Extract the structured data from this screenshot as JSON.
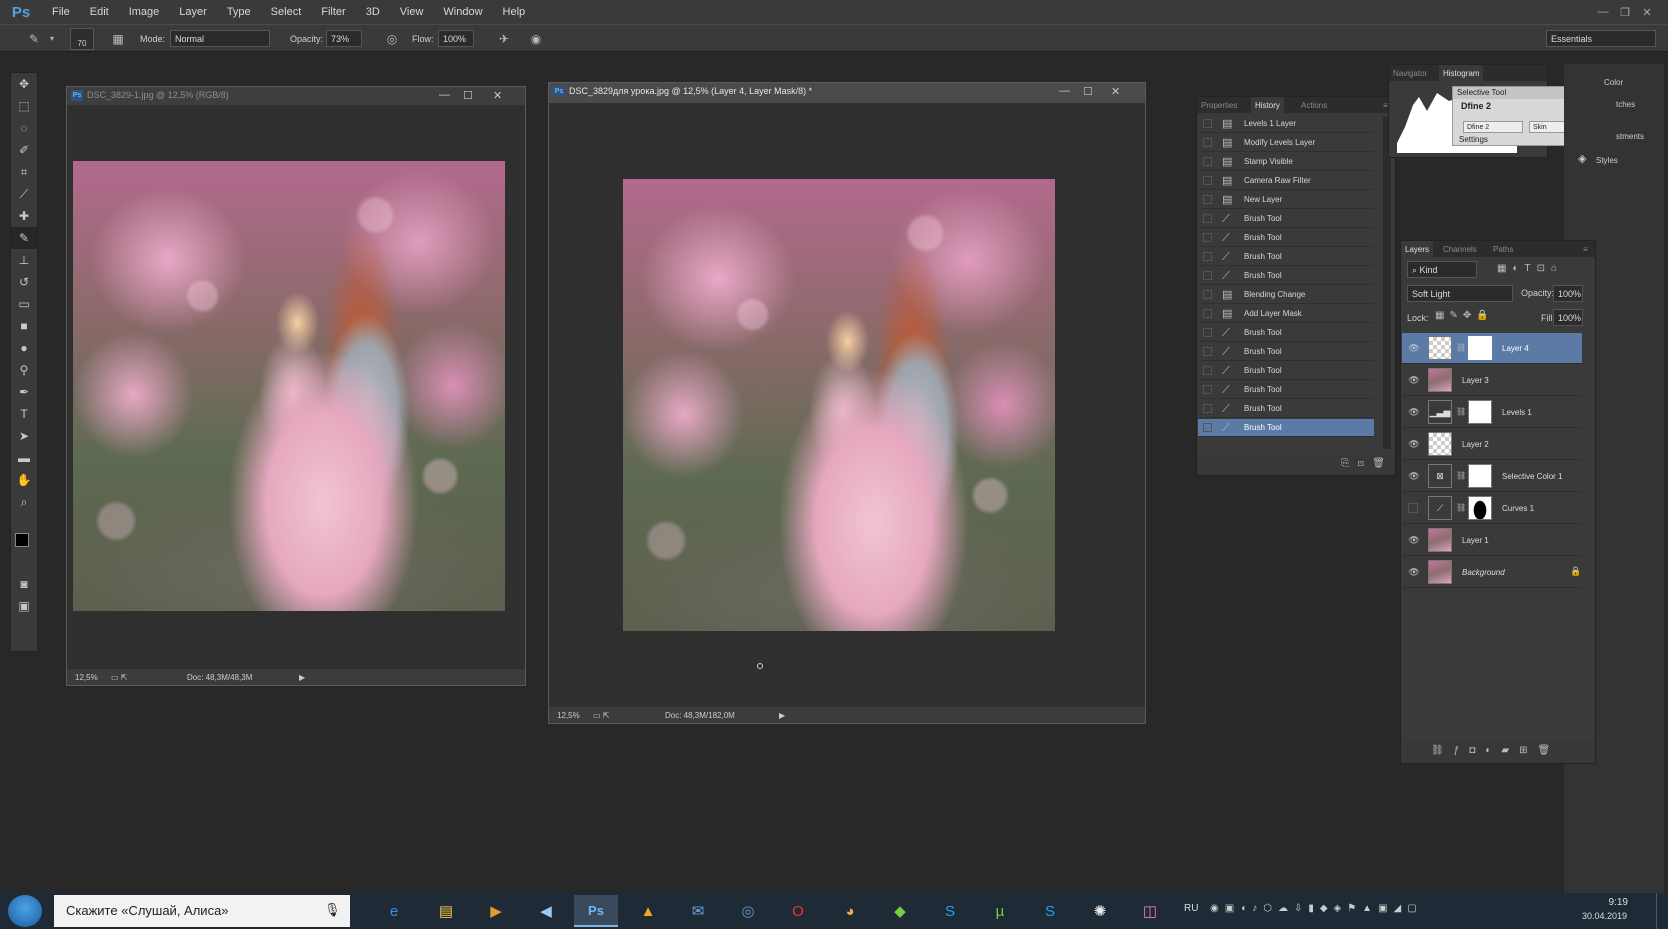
{
  "menubar": {
    "logo": "Ps",
    "items": [
      "File",
      "Edit",
      "Image",
      "Layer",
      "Type",
      "Select",
      "Filter",
      "3D",
      "View",
      "Window",
      "Help"
    ]
  },
  "options": {
    "brush_size": "70",
    "mode_label": "Mode:",
    "mode_value": "Normal",
    "opacity_label": "Opacity:",
    "opacity_value": "73%",
    "flow_label": "Flow:",
    "flow_value": "100%",
    "workspace": "Essentials"
  },
  "doc1": {
    "title": "DSC_3829-1.jpg @ 12,5% (RGB/8)",
    "zoom": "12,5%",
    "doc_size": "Doc: 48,3M/48,3M"
  },
  "doc2": {
    "title": "DSC_3829для урока.jpg @ 12,5% (Layer 4, Layer Mask/8) *",
    "zoom": "12,5%",
    "doc_size": "Doc: 48,3M/182,0M"
  },
  "history_panel": {
    "tabs": [
      "Properties",
      "History",
      "Actions"
    ],
    "active_tab": "History",
    "items": [
      {
        "label": "Levels 1 Layer",
        "icon": "doc-icon"
      },
      {
        "label": "Modify Levels Layer",
        "icon": "doc-icon"
      },
      {
        "label": "Stamp Visible",
        "icon": "doc-icon"
      },
      {
        "label": "Camera Raw Filter",
        "icon": "doc-icon"
      },
      {
        "label": "New Layer",
        "icon": "doc-icon"
      },
      {
        "label": "Brush Tool",
        "icon": "brush-icon"
      },
      {
        "label": "Brush Tool",
        "icon": "brush-icon"
      },
      {
        "label": "Brush Tool",
        "icon": "brush-icon"
      },
      {
        "label": "Brush Tool",
        "icon": "brush-icon"
      },
      {
        "label": "Blending Change",
        "icon": "doc-icon"
      },
      {
        "label": "Add Layer Mask",
        "icon": "doc-icon"
      },
      {
        "label": "Brush Tool",
        "icon": "brush-icon"
      },
      {
        "label": "Brush Tool",
        "icon": "brush-icon"
      },
      {
        "label": "Brush Tool",
        "icon": "brush-icon"
      },
      {
        "label": "Brush Tool",
        "icon": "brush-icon"
      },
      {
        "label": "Brush Tool",
        "icon": "brush-icon"
      },
      {
        "label": "Brush Tool",
        "icon": "brush-icon"
      }
    ],
    "selected_index": 16
  },
  "navigator_panel": {
    "tabs": [
      "Navigator",
      "Histogram"
    ],
    "active_tab": "Histogram"
  },
  "selective_tool": {
    "title": "Selective Tool",
    "group": "Dfine 2",
    "btn1": "Dfine 2",
    "btn2": "Skin",
    "settings": "Settings"
  },
  "side_dock": {
    "color": "Color",
    "swatches": "tches",
    "adjustments": "stments",
    "styles": "Styles"
  },
  "layers_panel": {
    "tabs": [
      "Layers",
      "Channels",
      "Paths"
    ],
    "active_tab": "Layers",
    "kind_label": "Kind",
    "blend_mode": "Soft Light",
    "opacity_label": "Opacity:",
    "opacity_value": "100%",
    "lock_label": "Lock:",
    "fill_label": "Fill:",
    "fill_value": "100%",
    "layers": [
      {
        "name": "Layer 4",
        "visible": true,
        "selected": true
      },
      {
        "name": "Layer 3",
        "visible": true,
        "selected": false
      },
      {
        "name": "Levels 1",
        "visible": true,
        "selected": false
      },
      {
        "name": "Layer 2",
        "visible": true,
        "selected": false
      },
      {
        "name": "Selective Color 1",
        "visible": true,
        "selected": false
      },
      {
        "name": "Curves 1",
        "visible": false,
        "selected": false
      },
      {
        "name": "Layer 1",
        "visible": true,
        "selected": false
      },
      {
        "name": "Background",
        "visible": true,
        "selected": false
      }
    ]
  },
  "taskbar": {
    "search_text": "Скажите «Слушай, Алиса»",
    "lang": "RU",
    "time": "9:19",
    "date": "30.04.2019"
  },
  "colors": {
    "accent": "#5b7aa6",
    "ps_blue": "#4fa3e0"
  }
}
